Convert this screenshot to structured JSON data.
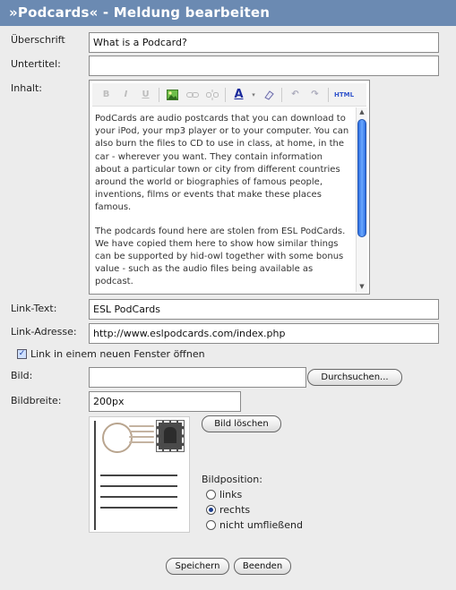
{
  "window": {
    "title": "»Podcards« - Meldung bearbeiten"
  },
  "form": {
    "heading": {
      "label": "Überschrift",
      "value": "What is a Podcard?"
    },
    "subtitle": {
      "label": "Untertitel:",
      "value": ""
    },
    "content": {
      "label": "Inhalt:",
      "paragraph1": "PodCards are audio postcards that you can download to your iPod, your mp3 player or to your computer. You can also burn the files to CD to use in class, at home, in the car - wherever you want. They contain information about a particular town or city from different countries around the world or biographies of famous people, inventions, films or events that make these places famous.",
      "paragraph2": "The podcards found here are stolen from ESL PodCards. We have copied them here to show how similar things can be supported by hid-owl together with some bonus value - such as the audio files being available as podcast.",
      "toolbar": [
        "B",
        "I",
        "U",
        "image",
        "link",
        "unlink",
        "A",
        "eraser",
        "undo",
        "redo",
        "HTML"
      ]
    },
    "link_text": {
      "label": "Link-Text:",
      "value": "ESL PodCards"
    },
    "link_address": {
      "label": "Link-Adresse:",
      "value": "http://www.eslpodcards.com/index.php"
    },
    "new_window": {
      "label": "Link in einem neuen Fenster öffnen",
      "checked": true
    },
    "image": {
      "label": "Bild:",
      "value": "",
      "browse_label": "Durchsuchen..."
    },
    "image_width": {
      "label": "Bildbreite:",
      "value": "200px"
    },
    "delete_image_label": "Bild löschen",
    "image_position": {
      "label": "Bildposition:",
      "options": [
        "links",
        "rechts",
        "nicht umfließend"
      ],
      "selected": "rechts"
    },
    "save_label": "Speichern",
    "finish_label": "Beenden"
  },
  "colors": {
    "titlebar": "#6b8ab2",
    "scroll_thumb": "#2d6fe0"
  }
}
